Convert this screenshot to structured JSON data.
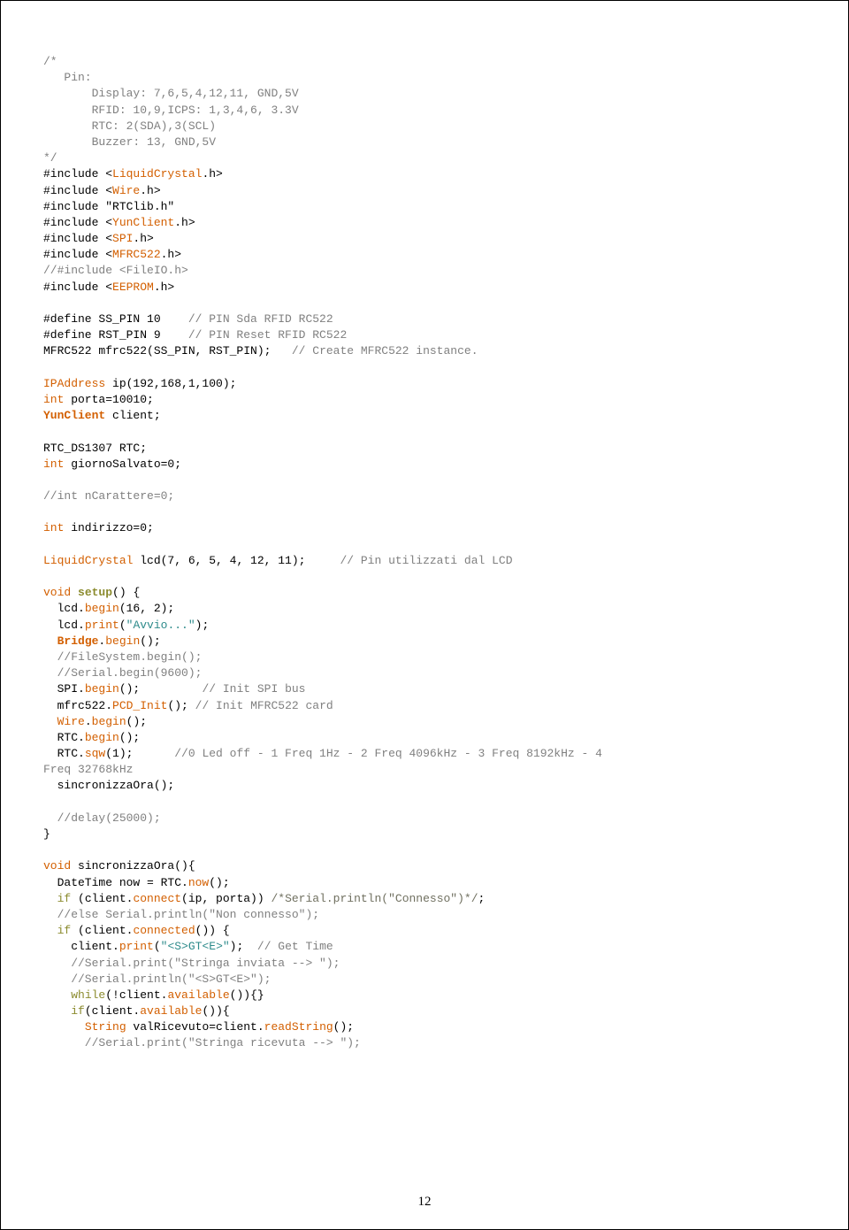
{
  "page_number": "12",
  "tokens": {
    "t0": "/*",
    "t1": "   Pin:",
    "t2": "       Display: 7,6,5,4,12,11, GND,5V",
    "t3": "       RFID: 10,9,ICPS: 1,3,4,6, 3.3V",
    "t4": "       RTC: 2(SDA),3(SCL)",
    "t5": "       Buzzer: 13, GND,5V",
    "t6": "*/",
    "t7": "#include <",
    "t8": "LiquidCrystal",
    "t9": ".h>",
    "t10": "Wire",
    "t11": "#include \"RTClib.h\"",
    "t12": "YunClient",
    "t13": "SPI",
    "t14": "MFRC522",
    "t15": "//#include <FileIO.h>",
    "t16": "EEPROM",
    "t17a": "#define SS_PIN 10    ",
    "t17b": "// PIN Sda RFID RC522",
    "t18a": "#define RST_PIN 9    ",
    "t18b": "// PIN Reset RFID RC522",
    "t19a": "MFRC522 mfrc522(SS_PIN, RST_PIN);   ",
    "t19b": "// Create MFRC522 instance.",
    "t20": "IPAddress",
    "t21": " ip(192,168,1,100);",
    "t22": "int",
    "t23": " porta=10010;",
    "t24": "YunClient",
    "t25": " client;",
    "t26": "RTC_DS1307 RTC;",
    "t27": " giornoSalvato=0;",
    "t28": "//int nCarattere=0;",
    "t29": " indirizzo=0;",
    "t30": "LiquidCrystal",
    "t31": " lcd(7, 6, 5, 4, 12, 11);     ",
    "t32": "// Pin utilizzati dal LCD",
    "t33": "void",
    "t34": " ",
    "t35": "setup",
    "t36": "() {",
    "t37": "  lcd.",
    "t38": "begin",
    "t39": "(16, 2);",
    "t40": "print",
    "t41": "(",
    "t42": "\"Avvio...\"",
    "t43": ");",
    "t44": "  ",
    "t45": "Bridge",
    "t46": ".",
    "t47": "();",
    "t48": "  //FileSystem.begin();",
    "t49": "  //Serial.begin(9600);",
    "t50": "  SPI.",
    "t51": "();         ",
    "t52": "// Init SPI bus",
    "t53": "  mfrc522.",
    "t54": "PCD_Init",
    "t55": "(); ",
    "t56": "// Init MFRC522 card",
    "t57": "  ",
    "t58": "Wire",
    "t59": "  RTC.",
    "t60": "sqw",
    "t61": "(1);      ",
    "t62": "//0 Led off - 1 Freq 1Hz - 2 Freq 4096kHz - 3 Freq 8192kHz - 4 ",
    "t63": "Freq 32768kHz",
    "t64": "  sincronizzaOra();",
    "t65": "  //delay(25000);",
    "t66": "}",
    "t67": " sincronizzaOra(){",
    "t68": "  DateTime now = RTC.",
    "t69": "now",
    "t70": "  ",
    "t71": "if",
    "t72": " (client.",
    "t73": "connect",
    "t74": "(ip, porta)) ",
    "t75": "/*Serial.println(\"Connesso\")*/",
    "t76": ";",
    "t77": "  //else Serial.println(\"Non connesso\");",
    "t78": "connected",
    "t79": "()) {",
    "t80": "    client.",
    "t81": "\"<S>GT<E>\"",
    "t82": ");  ",
    "t83": "// Get Time",
    "t84": "    //Serial.print(\"Stringa inviata --> \");",
    "t85": "    //Serial.println(\"<S>GT<E>\");",
    "t86": "    ",
    "t87": "while",
    "t88": "(!client.",
    "t89": "available",
    "t90": "()){}",
    "t91": "(client.",
    "t92": "()){",
    "t93": "      ",
    "t94": "String",
    "t95": " valRicevuto=client.",
    "t96": "readString",
    "t97": "      //Serial.print(\"Stringa ricevuta --> \");"
  }
}
